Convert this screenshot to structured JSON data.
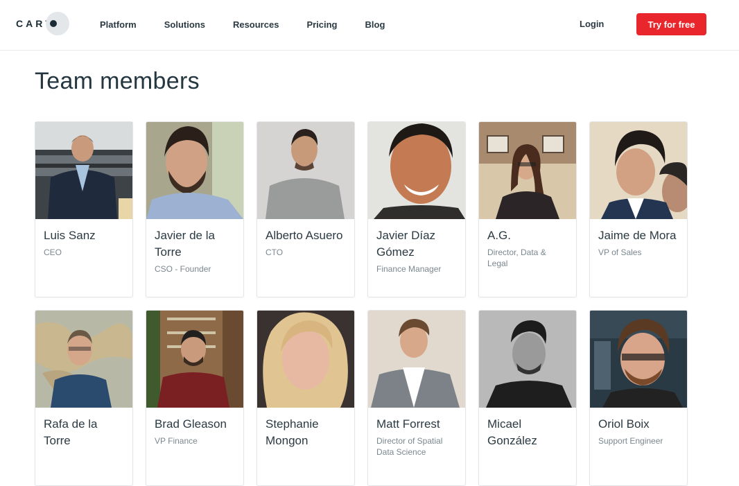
{
  "nav": {
    "logo_text": "CART",
    "items": [
      {
        "label": "Platform"
      },
      {
        "label": "Solutions"
      },
      {
        "label": "Resources"
      },
      {
        "label": "Pricing"
      },
      {
        "label": "Blog"
      }
    ],
    "login_label": "Login",
    "cta_label": "Try for free",
    "cta_color": "#e8262c"
  },
  "page": {
    "title": "Team members"
  },
  "members": [
    {
      "name": "Luis Sanz",
      "role": "CEO"
    },
    {
      "name": "Javier de la Torre",
      "role": "CSO - Founder"
    },
    {
      "name": "Alberto Asuero",
      "role": "CTO"
    },
    {
      "name": "Javier Díaz Gómez",
      "role": "Finance Manager"
    },
    {
      "name": "A.G.",
      "role": "Director, Data & Legal"
    },
    {
      "name": "Jaime de Mora",
      "role": "VP of Sales"
    },
    {
      "name": "Rafa de la Torre",
      "role": ""
    },
    {
      "name": "Brad Gleason",
      "role": "VP Finance"
    },
    {
      "name": "Stephanie Mongon",
      "role": ""
    },
    {
      "name": "Matt Forrest",
      "role": "Director of Spatial Data Science"
    },
    {
      "name": "Micael González",
      "role": ""
    },
    {
      "name": "Oriol Boix",
      "role": "Support Engineer"
    }
  ]
}
